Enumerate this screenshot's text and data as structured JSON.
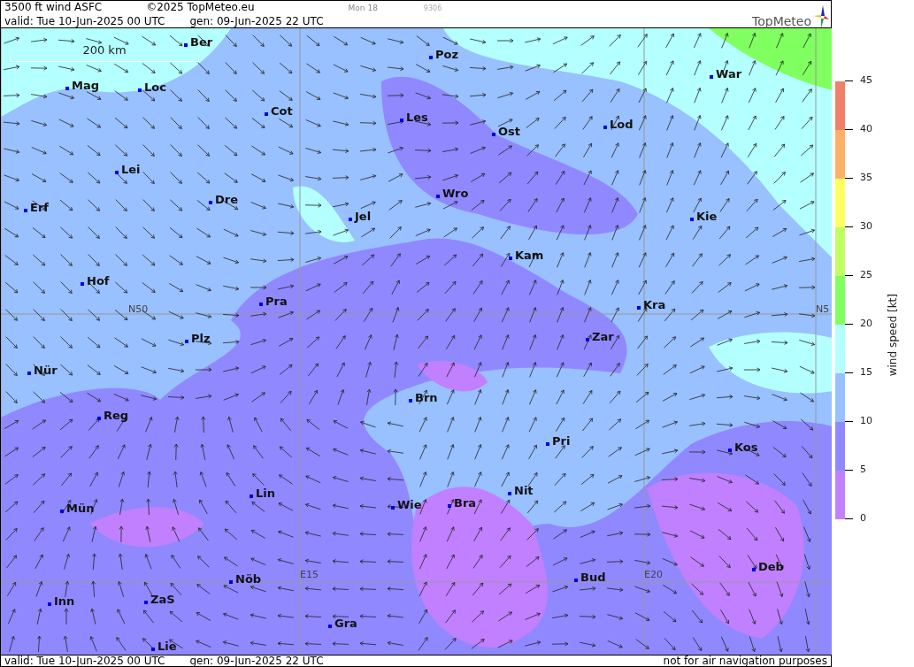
{
  "header": {
    "product": "3500 ft wind ASFC",
    "copyright": "©2025 TopMeteo.eu",
    "model_run": "Mon 18",
    "code": "9306",
    "valid": "valid:  Tue  10-Jun-2025  00 UTC",
    "generated": "gen: 09-Jun-2025 22 UTC",
    "logo": "TopMeteo"
  },
  "map": {
    "scale": "200 km",
    "grid_labels": [
      "N50",
      "N5",
      "E15",
      "E20"
    ],
    "cities": [
      "Ber",
      "Poz",
      "War",
      "Mag",
      "Loc",
      "Cot",
      "Les",
      "Lod",
      "Ost",
      "Lei",
      "Wro",
      "Dre",
      "Erf",
      "Jel",
      "Kie",
      "Kam",
      "Hof",
      "Kra",
      "Pra",
      "Zar",
      "Plz",
      "Nür",
      "Brn",
      "Reg",
      "Pri",
      "Kos",
      "Lin",
      "Nit",
      "Wie",
      "Bra",
      "Mün",
      "Deb",
      "Bud",
      "Nöb",
      "Inn",
      "ZaS",
      "Gra",
      "Lie"
    ]
  },
  "legend": {
    "title": "wind speed [kt]",
    "bands": [
      {
        "label": "45",
        "color": "#f08068"
      },
      {
        "label": "40",
        "color": "#ffb068"
      },
      {
        "label": "35",
        "color": "#ffff60"
      },
      {
        "label": "30",
        "color": "#c0ff60"
      },
      {
        "label": "25",
        "color": "#80ff60"
      },
      {
        "label": "20",
        "color": "#b4ffff"
      },
      {
        "label": "15",
        "color": "#99c0ff"
      },
      {
        "label": "10",
        "color": "#9088ff"
      },
      {
        "label": "5",
        "color": "#c080ff"
      }
    ],
    "bottom_label": "0"
  },
  "footer": {
    "valid": "valid:  Tue  10-Jun-2025  00 UTC",
    "generated": "gen: 09-Jun-2025 22 UTC",
    "disclaimer": "not for air navigation purposes"
  }
}
